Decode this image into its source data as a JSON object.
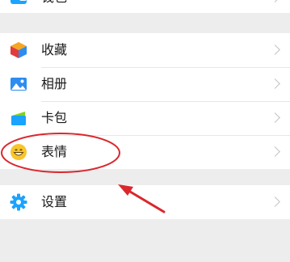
{
  "groups": {
    "top": {
      "wallet_label": "钱包"
    },
    "media": {
      "favorites_label": "收藏",
      "album_label": "相册",
      "cards_label": "卡包",
      "stickers_label": "表情"
    },
    "settings": {
      "settings_label": "设置"
    }
  },
  "icons": {
    "wallet": "wallet-icon",
    "favorites": "favorites-cube-icon",
    "album": "album-image-icon",
    "cards": "card-wallet-icon",
    "stickers": "smiley-icon",
    "settings": "gear-icon"
  },
  "colors": {
    "background": "#ededed",
    "row_background": "#ffffff",
    "annotation_red": "#d9282e",
    "accent_blue": "#1aa3ff"
  }
}
